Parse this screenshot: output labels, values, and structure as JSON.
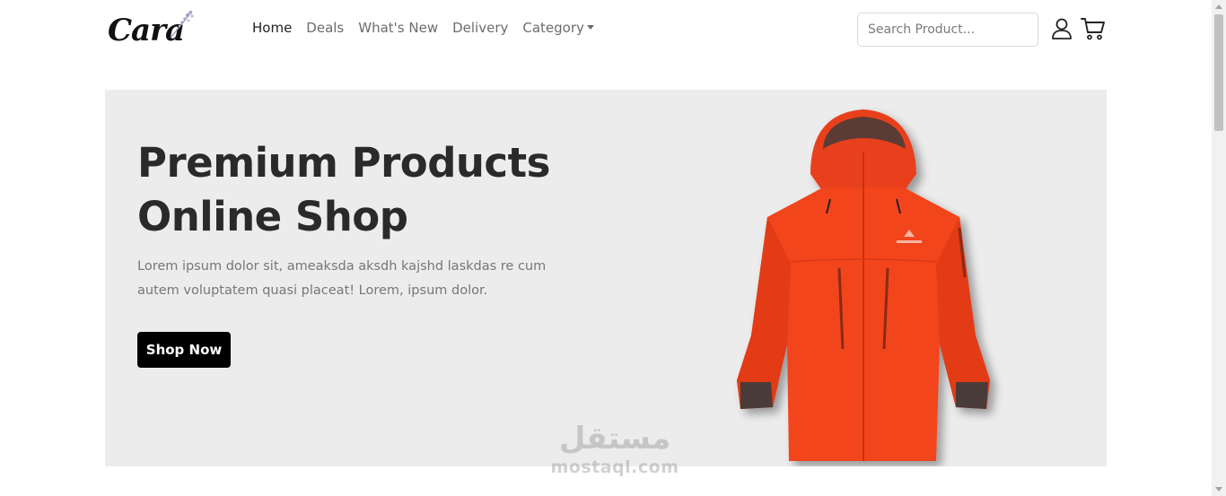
{
  "brand": {
    "logo_text": "Cara"
  },
  "nav": {
    "items": [
      {
        "label": "Home",
        "active": true
      },
      {
        "label": "Deals",
        "active": false
      },
      {
        "label": "What's New",
        "active": false
      },
      {
        "label": "Delivery",
        "active": false
      },
      {
        "label": "Category",
        "active": false,
        "dropdown": true
      }
    ]
  },
  "search": {
    "placeholder": "Search Product..."
  },
  "icons": {
    "user": "user-icon",
    "cart": "cart-icon"
  },
  "hero": {
    "title_line1": "Premium Products",
    "title_line2": "Online Shop",
    "description": "Lorem ipsum dolor sit, ameaksda aksdh kajshd laskdas re cum autem voluptatem quasi placeat! Lorem, ipsum dolor.",
    "button_label": "Shop Now",
    "background": "#ececec",
    "product_color": "#f2441c"
  },
  "watermark": {
    "arabic": "مستقل",
    "url": "mostaql.com"
  }
}
